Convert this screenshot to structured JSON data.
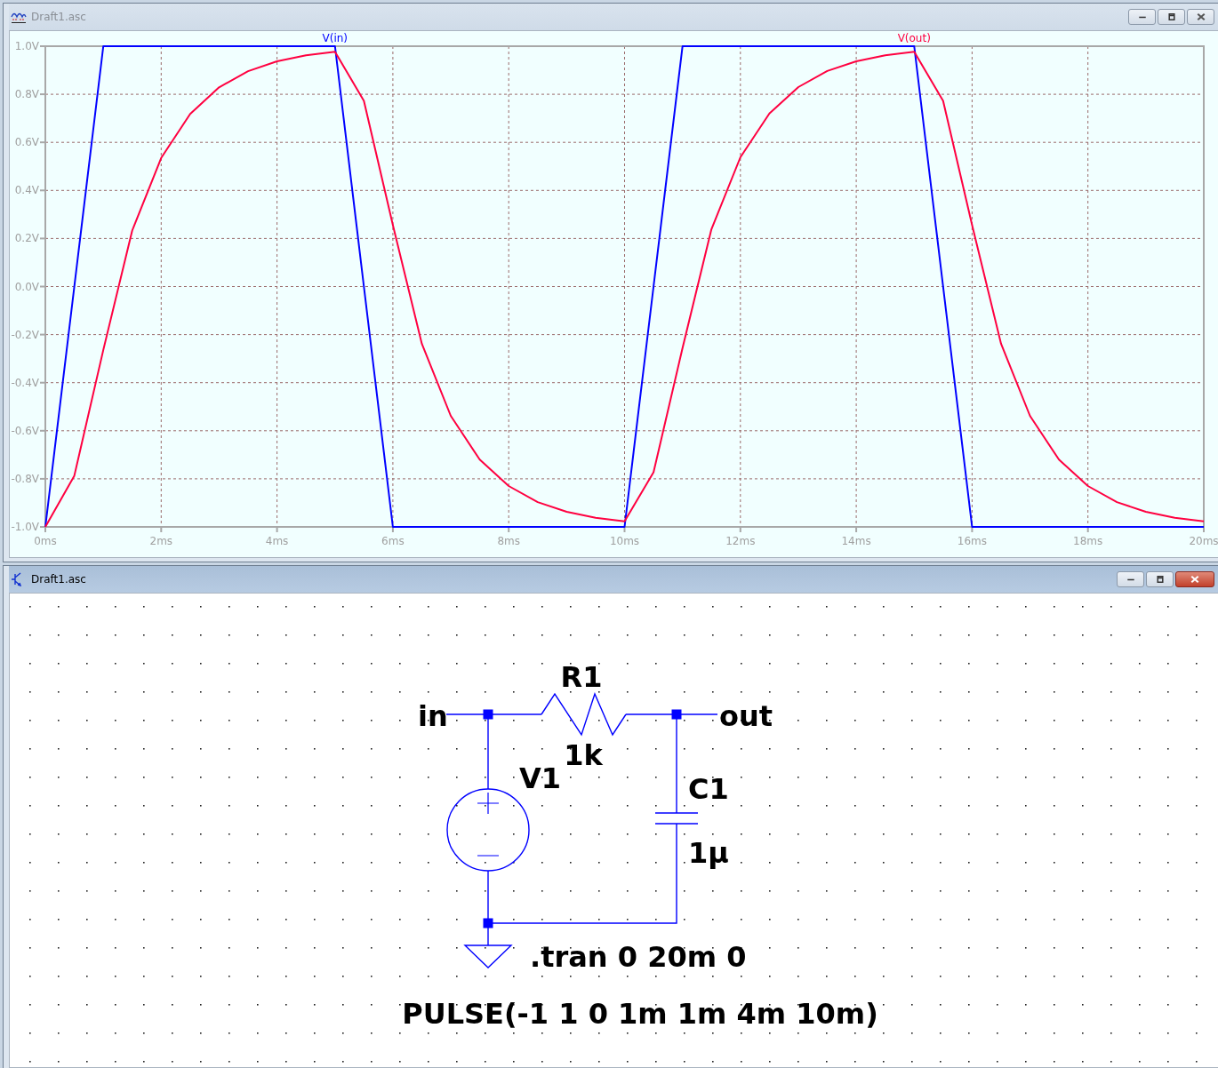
{
  "waveform_window": {
    "title": "Draft1.asc",
    "active": false,
    "chart_data": {
      "type": "line",
      "x": [
        0,
        0.5,
        1,
        1.5,
        2,
        2.5,
        3,
        3.5,
        4,
        4.5,
        5,
        5.5,
        6,
        6.5,
        7,
        7.5,
        8,
        8.5,
        9,
        9.5,
        10,
        10.5,
        11,
        11.5,
        12,
        12.5,
        13,
        13.5,
        14,
        14.5,
        15,
        15.5,
        16,
        16.5,
        17,
        17.5,
        18,
        18.5,
        19,
        19.5,
        20
      ],
      "series": [
        {
          "name": "V(in)",
          "color": "#0000ff",
          "values": [
            -1,
            0,
            1,
            1,
            1,
            1,
            1,
            1,
            1,
            1,
            1,
            0,
            -1,
            -1,
            -1,
            -1,
            -1,
            -1,
            -1,
            -1,
            -1,
            0,
            1,
            1,
            1,
            1,
            1,
            1,
            1,
            1,
            1,
            0,
            -1,
            -1,
            -1,
            -1,
            -1,
            -1,
            -1,
            -1,
            -1
          ]
        },
        {
          "name": "V(out)",
          "color": "#ff0040",
          "values": [
            -1,
            -0.787,
            -0.264,
            0.233,
            0.535,
            0.718,
            0.829,
            0.896,
            0.937,
            0.962,
            0.977,
            0.773,
            0.256,
            -0.238,
            -0.538,
            -0.72,
            -0.83,
            -0.897,
            -0.937,
            -0.962,
            -0.977,
            -0.773,
            -0.256,
            0.238,
            0.538,
            0.72,
            0.83,
            0.897,
            0.937,
            0.962,
            0.977,
            0.773,
            0.256,
            -0.238,
            -0.538,
            -0.72,
            -0.83,
            -0.897,
            -0.937,
            -0.962,
            -0.977
          ]
        }
      ],
      "xlim": [
        0,
        20
      ],
      "ylim": [
        -1,
        1
      ],
      "grid": true,
      "xticks": [
        {
          "value": 0,
          "label": "0ms"
        },
        {
          "value": 2,
          "label": "2ms"
        },
        {
          "value": 4,
          "label": "4ms"
        },
        {
          "value": 6,
          "label": "6ms"
        },
        {
          "value": 8,
          "label": "8ms"
        },
        {
          "value": 10,
          "label": "10ms"
        },
        {
          "value": 12,
          "label": "12ms"
        },
        {
          "value": 14,
          "label": "14ms"
        },
        {
          "value": 16,
          "label": "16ms"
        },
        {
          "value": 18,
          "label": "18ms"
        },
        {
          "value": 20,
          "label": "20ms"
        }
      ],
      "yticks": [
        {
          "value": 1,
          "label": "1.0V"
        },
        {
          "value": 0.8,
          "label": "0.8V"
        },
        {
          "value": 0.6,
          "label": "0.6V"
        },
        {
          "value": 0.4,
          "label": "0.4V"
        },
        {
          "value": 0.2,
          "label": "0.2V"
        },
        {
          "value": 0,
          "label": "0.0V"
        },
        {
          "value": -0.2,
          "label": "-0.2V"
        },
        {
          "value": -0.4,
          "label": "-0.4V"
        },
        {
          "value": -0.6,
          "label": "-0.6V"
        },
        {
          "value": -0.8,
          "label": "-0.8V"
        },
        {
          "value": -1,
          "label": "-1.0V"
        }
      ]
    }
  },
  "schematic_window": {
    "title": "Draft1.asc",
    "active": true,
    "net_labels": [
      {
        "text": "in"
      },
      {
        "text": "out"
      }
    ],
    "components": [
      {
        "kind": "resistor",
        "name": "R1",
        "value": "1k"
      },
      {
        "kind": "voltage_source",
        "name": "V1",
        "value": "PULSE(-1 1 0 1m 1m 4m 10m)"
      },
      {
        "kind": "capacitor",
        "name": "C1",
        "value": "1µ"
      }
    ],
    "directives": [
      ".tran 0 20m 0"
    ]
  }
}
